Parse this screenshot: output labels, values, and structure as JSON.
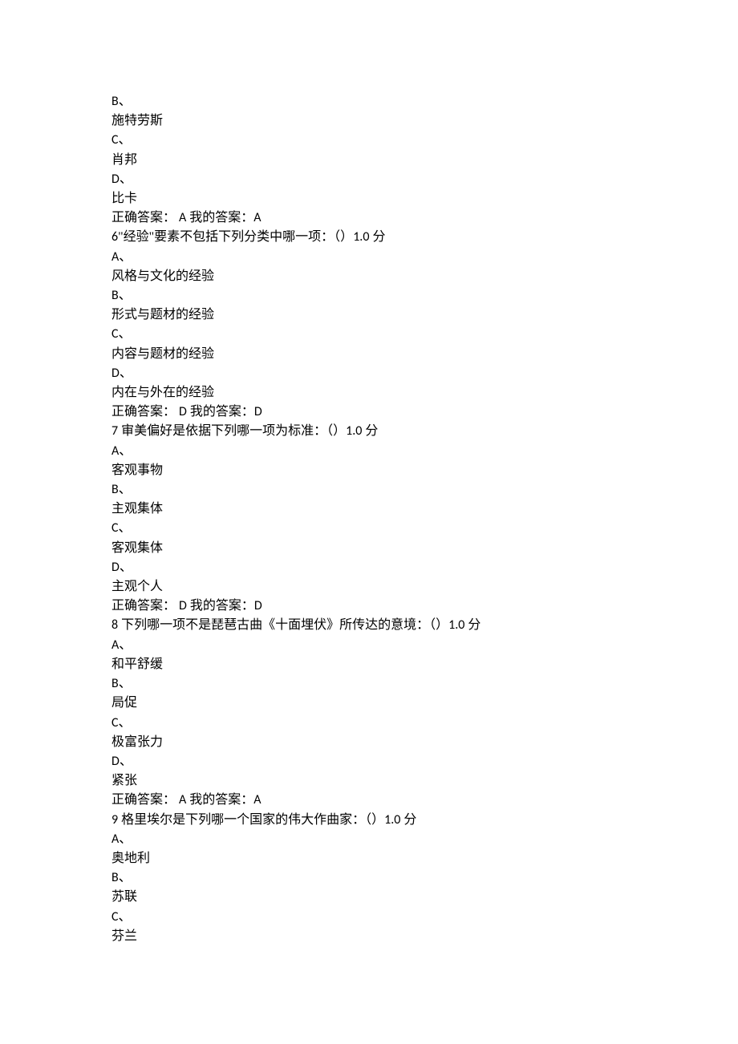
{
  "q5_tail": {
    "optB_letter": "B、",
    "optB_text": "施特劳斯",
    "optC_letter": "C、",
    "optC_text": "肖邦",
    "optD_letter": "D、",
    "optD_text": "比卡",
    "answer_prefix": "正确答案： ",
    "answer_correct": "A",
    "answer_mid": " 我的答案：",
    "answer_mine": "A"
  },
  "q6": {
    "num": "6",
    "stem": "\"经验\"要素不包括下列分类中哪一项：（）",
    "score": "1.0",
    "score_suffix": " 分",
    "optA_letter": "A、",
    "optA_text": "风格与文化的经验",
    "optB_letter": "B、",
    "optB_text": "形式与题材的经验",
    "optC_letter": "C、",
    "optC_text": "内容与题材的经验",
    "optD_letter": "D、",
    "optD_text": "内在与外在的经验",
    "answer_prefix": "正确答案： ",
    "answer_correct": "D",
    "answer_mid": " 我的答案：",
    "answer_mine": "D"
  },
  "q7": {
    "num": "7",
    "stem": " 审美偏好是依据下列哪一项为标准：（）",
    "score": "1.0",
    "score_suffix": " 分",
    "optA_letter": "A、",
    "optA_text": "客观事物",
    "optB_letter": "B、",
    "optB_text": "主观集体",
    "optC_letter": "C、",
    "optC_text": "客观集体",
    "optD_letter": "D、",
    "optD_text": "主观个人",
    "answer_prefix": "正确答案： ",
    "answer_correct": "D",
    "answer_mid": " 我的答案：",
    "answer_mine": "D"
  },
  "q8": {
    "num": "8",
    "stem": " 下列哪一项不是琵琶古曲《十面埋伏》所传达的意境：（）",
    "score": "1.0",
    "score_suffix": " 分",
    "optA_letter": "A、",
    "optA_text": "和平舒缓",
    "optB_letter": "B、",
    "optB_text": "局促",
    "optC_letter": "C、",
    "optC_text": "极富张力",
    "optD_letter": "D、",
    "optD_text": "紧张",
    "answer_prefix": "正确答案： ",
    "answer_correct": "A",
    "answer_mid": " 我的答案：",
    "answer_mine": "A"
  },
  "q9": {
    "num": "9",
    "stem": " 格里埃尔是下列哪一个国家的伟大作曲家：（）",
    "score": "1.0",
    "score_suffix": " 分",
    "optA_letter": "A、",
    "optA_text": "奥地利",
    "optB_letter": "B、",
    "optB_text": "苏联",
    "optC_letter": "C、",
    "optC_text": "芬兰"
  }
}
